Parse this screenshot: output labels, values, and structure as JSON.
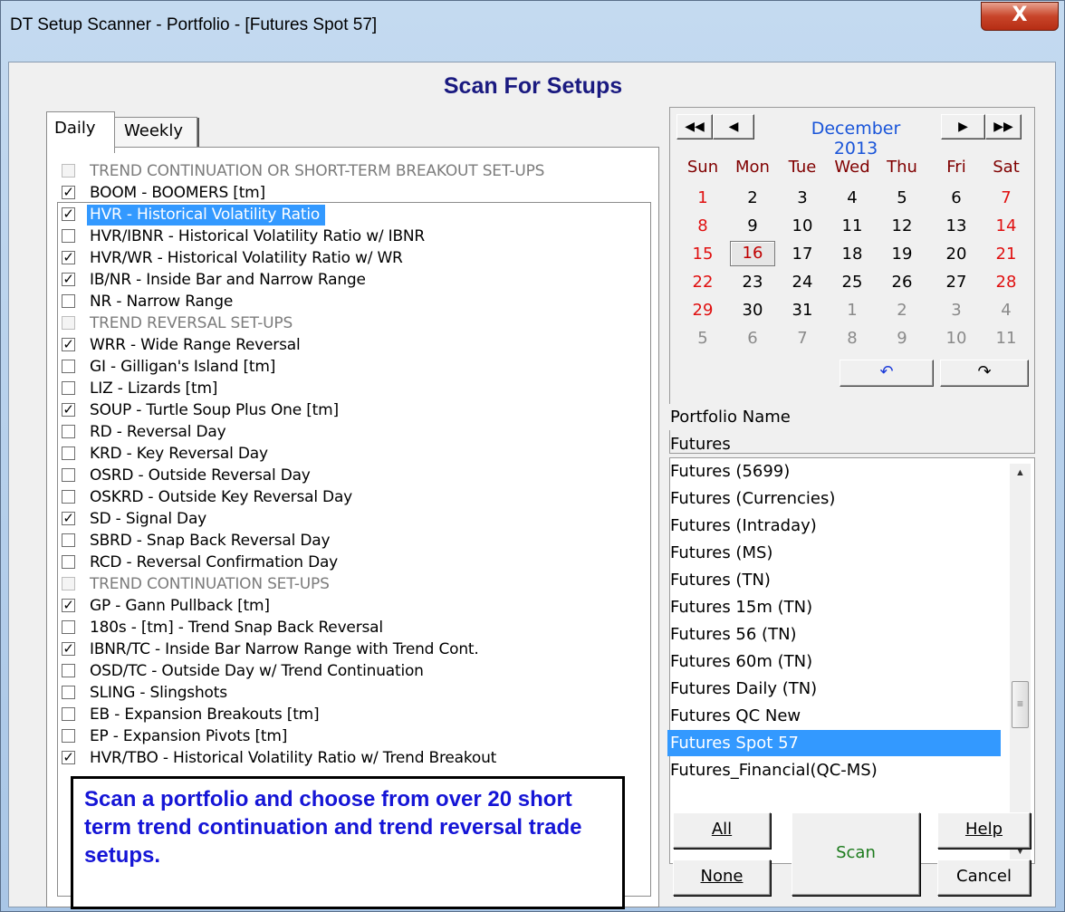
{
  "window": {
    "title": "DT Setup Scanner - Portfolio - [Futures Spot 57]",
    "close_glyph": "X"
  },
  "heading": "Scan For Setups",
  "tabs": [
    {
      "label": "Daily",
      "active": true
    },
    {
      "label": "Weekly",
      "active": false
    }
  ],
  "setups": [
    {
      "label": "TREND CONTINUATION OR SHORT-TERM BREAKOUT SET-UPS",
      "header": true,
      "checked": false
    },
    {
      "label": "BOOM - BOOMERS [tm]",
      "checked": true
    },
    {
      "label": "HVR - Historical Volatility Ratio",
      "checked": true,
      "selected": true
    },
    {
      "label": "HVR/IBNR - Historical Volatility Ratio w/ IBNR",
      "checked": false
    },
    {
      "label": "HVR/WR - Historical Volatility Ratio w/ WR",
      "checked": true
    },
    {
      "label": "IB/NR - Inside Bar and Narrow Range",
      "checked": true
    },
    {
      "label": "NR - Narrow Range",
      "checked": false
    },
    {
      "label": "TREND REVERSAL SET-UPS",
      "header": true,
      "checked": false
    },
    {
      "label": "WRR - Wide Range Reversal",
      "checked": true
    },
    {
      "label": "GI - Gilligan's Island [tm]",
      "checked": false
    },
    {
      "label": "LIZ - Lizards [tm]",
      "checked": false
    },
    {
      "label": "SOUP - Turtle Soup Plus One [tm]",
      "checked": true
    },
    {
      "label": "RD - Reversal Day",
      "checked": false
    },
    {
      "label": "KRD - Key Reversal Day",
      "checked": false
    },
    {
      "label": "OSRD - Outside Reversal Day",
      "checked": false
    },
    {
      "label": "OSKRD - Outside Key Reversal Day",
      "checked": false
    },
    {
      "label": "SD - Signal Day",
      "checked": true
    },
    {
      "label": "SBRD - Snap Back Reversal Day",
      "checked": false
    },
    {
      "label": "RCD - Reversal Confirmation Day",
      "checked": false
    },
    {
      "label": "TREND CONTINUATION SET-UPS",
      "header": true,
      "checked": false
    },
    {
      "label": "GP - Gann Pullback [tm]",
      "checked": true
    },
    {
      "label": "180s -  [tm] - Trend Snap Back Reversal",
      "checked": false
    },
    {
      "label": "IBNR/TC - Inside Bar Narrow Range with Trend Cont.",
      "checked": true
    },
    {
      "label": "OSD/TC - Outside Day w/ Trend Continuation",
      "checked": false
    },
    {
      "label": "SLING - Slingshots",
      "checked": false
    },
    {
      "label": "EB - Expansion Breakouts [tm]",
      "checked": false
    },
    {
      "label": "EP - Expansion Pivots [tm]",
      "checked": false
    },
    {
      "label": "HVR/TBO - Historical Volatility Ratio w/ Trend Breakout",
      "checked": true
    }
  ],
  "note": "Scan a portfolio and choose from over 20 short term trend continuation and trend reversal trade setups.",
  "calendar": {
    "month_label": "December 2013",
    "nav": {
      "first": "◀◀",
      "prev": "◀",
      "next": "▶",
      "last": "▶▶"
    },
    "weekdays": [
      "Sun",
      "Mon",
      "Tue",
      "Wed",
      "Thu",
      "Fri",
      "Sat"
    ],
    "weeks": [
      [
        "1",
        "2",
        "3",
        "4",
        "5",
        "6",
        "7"
      ],
      [
        "8",
        "9",
        "10",
        "11",
        "12",
        "13",
        "14"
      ],
      [
        "15",
        "16",
        "17",
        "18",
        "19",
        "20",
        "21"
      ],
      [
        "22",
        "23",
        "24",
        "25",
        "26",
        "27",
        "28"
      ],
      [
        "29",
        "30",
        "31",
        "1",
        "2",
        "3",
        "4"
      ],
      [
        "5",
        "6",
        "7",
        "8",
        "9",
        "10",
        "11"
      ]
    ],
    "today": "16",
    "undo_glyph": "↶",
    "redo_glyph": "↷",
    "colors": {
      "weekend": "#e01010",
      "month": "#1a55d9",
      "weekday_header": "#800000",
      "other_month": "#8a8a8a"
    }
  },
  "portfolios": {
    "header": "Portfolio Name",
    "items": [
      "Futures",
      "Futures (5699)",
      "Futures (Currencies)",
      "Futures (Intraday)",
      "Futures (MS)",
      "Futures (TN)",
      "Futures 15m (TN)",
      "Futures 56 (TN)",
      "Futures 60m (TN)",
      "Futures Daily (TN)",
      "Futures QC New",
      "Futures Spot 57",
      "Futures_Financial(QC-MS)"
    ],
    "selected": "Futures Spot 57"
  },
  "buttons": {
    "all": "All",
    "none": "None",
    "scan": "Scan",
    "help": "Help",
    "cancel": "Cancel"
  },
  "colors": {
    "selection": "#3399ff",
    "heading": "#1a1a80",
    "note_text": "#1515d6",
    "scan_text": "#1b7a1b"
  }
}
